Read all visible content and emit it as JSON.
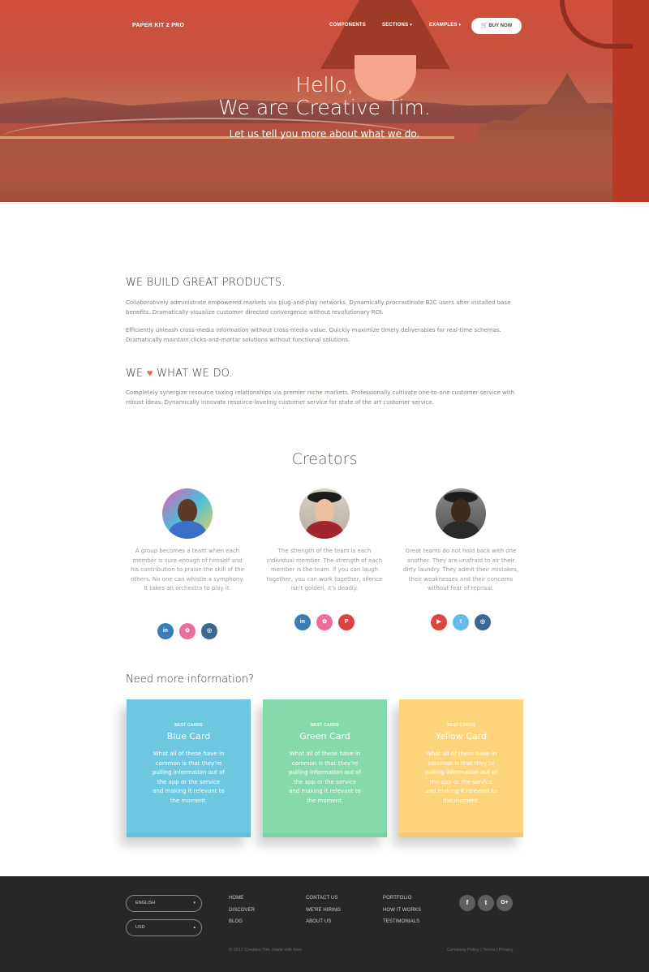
{
  "nav": {
    "brand": "PAPER KIT 2 PRO",
    "items": [
      {
        "label": "COMPONENTS"
      },
      {
        "label": "SECTIONS"
      },
      {
        "label": "EXAMPLES"
      }
    ],
    "buy_now": "BUY NOW"
  },
  "hero": {
    "line1": "Hello,",
    "line2": "We are Creative Tim.",
    "subtitle": "Let us tell you more about what we do."
  },
  "about": {
    "title1": "WE BUILD GREAT PRODUCTS.",
    "para1": "Collaboratively administrate empowered markets via plug-and-play networks. Dynamically procrastinate B2C users after installed base benefits. Dramatically visualize customer directed convergence without revolutionary ROI.",
    "para2": "Efficiently unleash cross-media information without cross-media value. Quickly maximize timely deliverables for real-time schemas. Dramatically maintain clicks-and-mortar solutions without functional solutions.",
    "title2_pre": "WE",
    "title2_post": "WHAT WE DO.",
    "para3": "Completely synergize resource taxing relationships via premier niche markets. Professionally cultivate one-to-one customer service with robust ideas. Dynamically innovate resource-leveling customer service for state of the art customer service."
  },
  "creators": {
    "title": "Creators",
    "items": [
      {
        "text": "A group becomes a team when each member is sure enough of himself and his contribution to praise the skill of the others. No one can whistle a symphony. It takes an orchestra to play it.",
        "socials": [
          "in",
          "✿",
          "◎"
        ]
      },
      {
        "text": "The strength of the team is each individual member. The strength of each member is the team. If you can laugh together, you can work together, silence isn't golden, it's deadly.",
        "socials": [
          "in",
          "✿",
          "P"
        ]
      },
      {
        "text": "Great teams do not hold back with one another. They are unafraid to air their dirty laundry. They admit their mistakes, their weaknesses and their concerns without fear of reprisal.",
        "socials": [
          "▶",
          "t",
          "◎"
        ]
      }
    ]
  },
  "info": {
    "title": "Need more information?",
    "cards": [
      {
        "category": "BEST CARDS",
        "title": "Blue Card",
        "text": "What all of these have in common is that they're pulling information out of the app or the service and making it relevant to the moment.",
        "color": "#6ec7e0"
      },
      {
        "category": "BEST CARDS",
        "title": "Green Card",
        "text": "What all of these have in common is that they're pulling information out of the app or the service and making it relevant to the moment.",
        "color": "#86d9ab"
      },
      {
        "category": "BEST CARDS",
        "title": "Yellow Card",
        "text": "What all of these have in common is that they're pulling information out of the app or the service and making it relevant to the moment.",
        "color": "#fdd47c"
      }
    ]
  },
  "footer": {
    "language": "ENGLISH",
    "currency": "USD",
    "col1": [
      "HOME",
      "DISCOVER",
      "BLOG"
    ],
    "col2": [
      "CONTACT US",
      "WE'RE HIRING",
      "ABOUT US"
    ],
    "col3": [
      "PORTFOLIO",
      "HOW IT WORKS",
      "TESTIMONIALS"
    ],
    "socials": [
      "f",
      "t",
      "G+"
    ],
    "copyright": "© 2017 Creative Tim, made with love",
    "legal": "Company Policy | Terms | Privacy"
  },
  "colors": {
    "accent": "#f26a3c",
    "footer_bg": "#292726",
    "social_linkedin": "#3b7db3",
    "social_dribbble": "#ea6ea0",
    "social_instagram": "#3c6792",
    "social_pinterest": "#d94545",
    "social_youtube": "#e0453d",
    "social_twitter": "#66b9e9"
  }
}
